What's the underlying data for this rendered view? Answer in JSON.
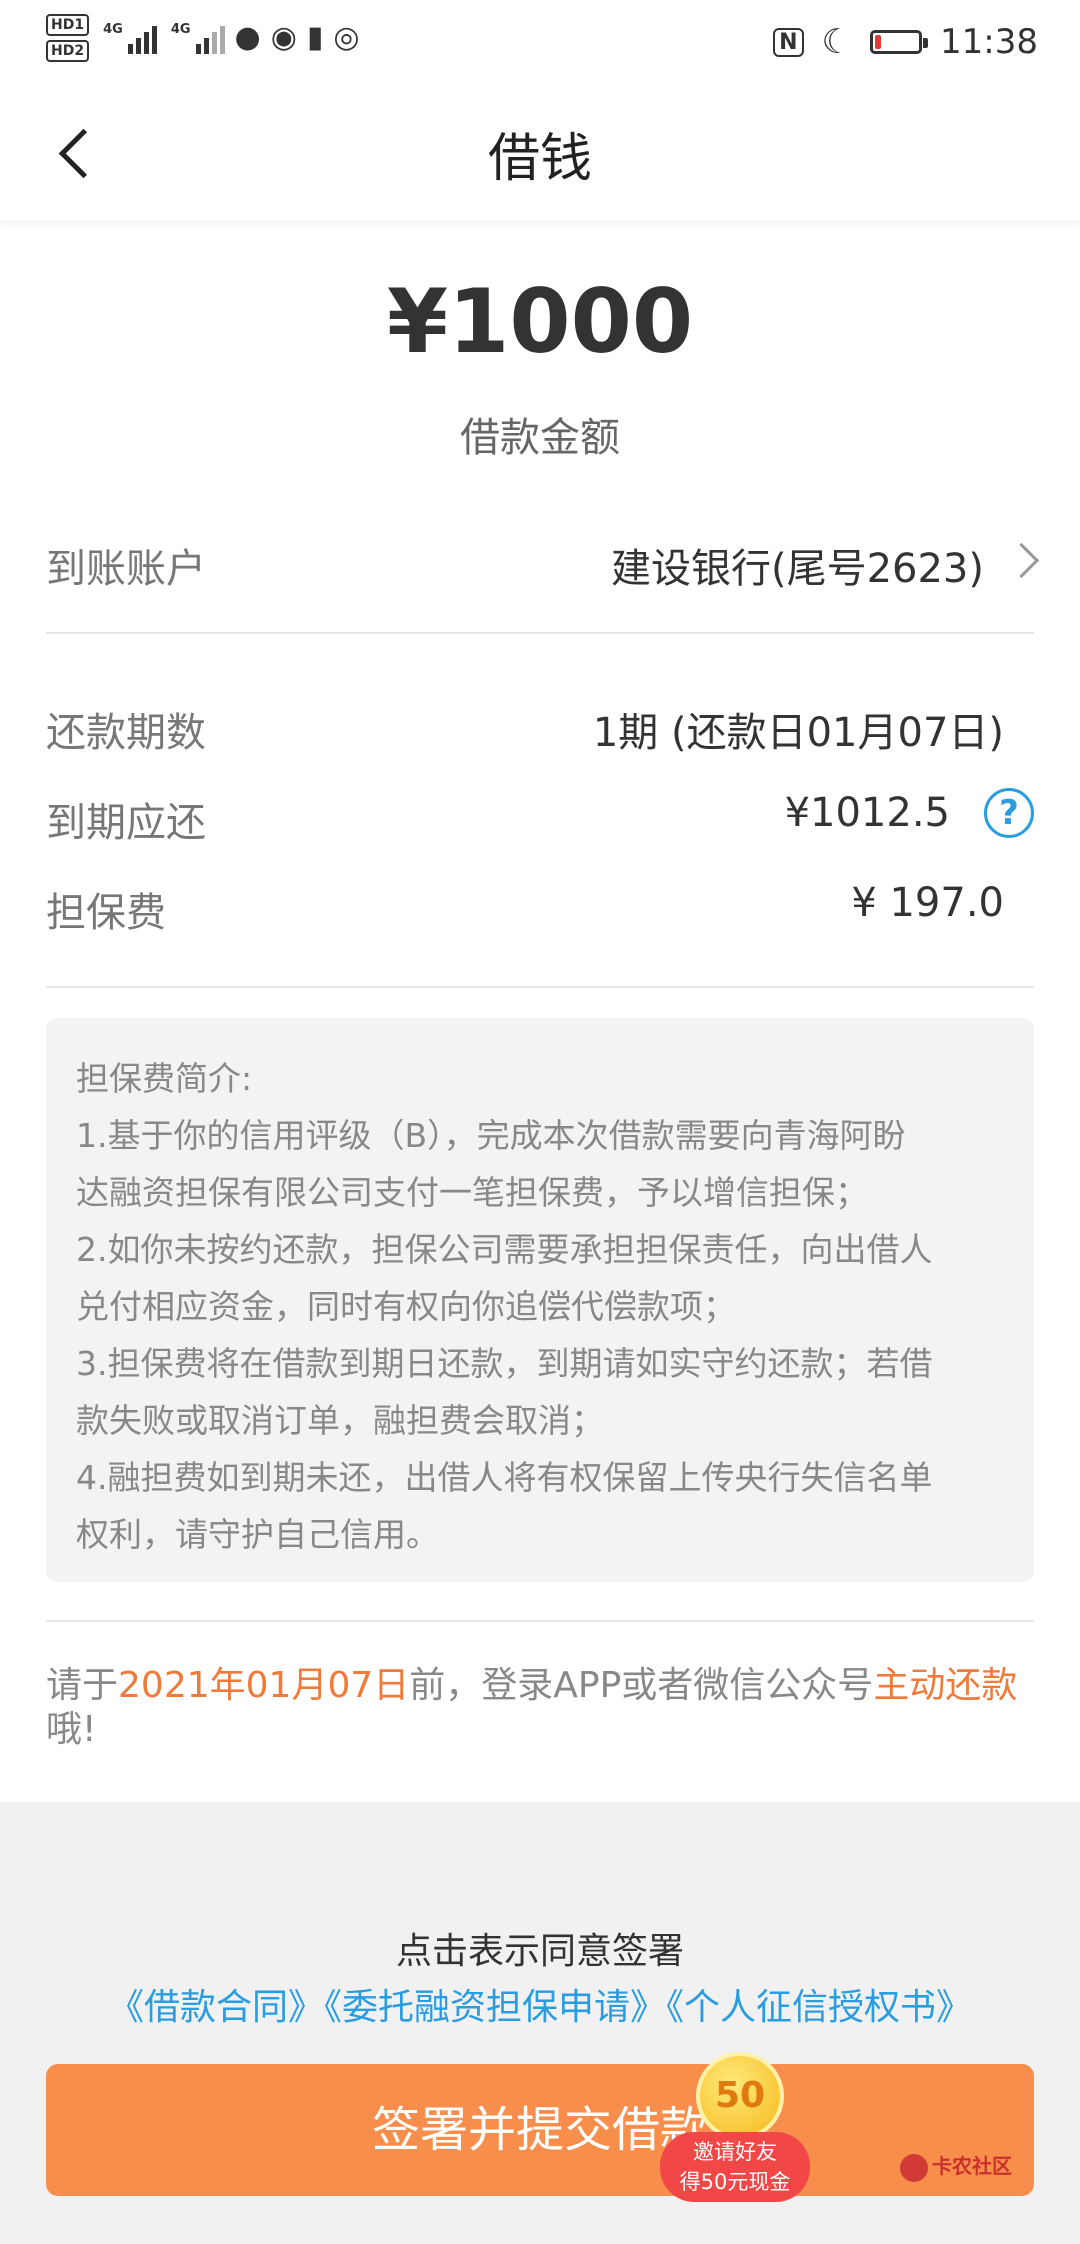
{
  "status_bar": {
    "hd1": "HD1",
    "hd2": "HD2",
    "network1": "4G",
    "network2": "4G",
    "nfc": "N",
    "time": "11:38",
    "battery_level": 0.15,
    "icons": [
      "message-icon",
      "wechat-icon",
      "battery-alert-icon",
      "hotspot-icon",
      "nfc-icon",
      "moon-icon",
      "battery-icon"
    ]
  },
  "header": {
    "title": "借钱"
  },
  "loan": {
    "amount": "¥1000",
    "amount_label": "借款金额"
  },
  "account": {
    "label": "到账账户",
    "value": "建设银行(尾号2623)"
  },
  "details": {
    "periods_label": "还款期数",
    "periods_value": "1期 (还款日01月07日)",
    "due_label": "到期应还",
    "due_value": "¥1012.5",
    "fee_label": "担保费",
    "fee_value": "¥ 197.0"
  },
  "fee_info": {
    "title": "担保费简介:",
    "lines": [
      "1.基于你的信用评级（B），完成本次借款需要向青海阿盼",
      "达融资担保有限公司支付一笔担保费，予以增信担保；",
      "2.如你未按约还款，担保公司需要承担担保责任，向出借人",
      "兑付相应资金，同时有权向你追偿代偿款项；",
      "3.担保费将在借款到期日还款，到期请如实守约还款；若借",
      "款失败或取消订单，融担费会取消；",
      "4.融担费如到期未还，出借人将有权保留上传央行失信名单",
      "权利，请守护自己信用。"
    ]
  },
  "notice": {
    "prefix": "请于",
    "date": "2021年01月07日",
    "middle": "前，登录APP或者微信公众号",
    "action": "主动还款",
    "suffix": "哦!"
  },
  "agreement": {
    "intro": "点击表示同意签署",
    "links": [
      "《借款合同》",
      "《委托融资担保申请》",
      "《个人征信授权书》"
    ]
  },
  "submit_label": "签署并提交借款",
  "promo": {
    "coin": "50",
    "line1": "邀请好友",
    "line2": "得50元现金"
  },
  "watermark": "卡农社区",
  "colors": {
    "accent_orange": "#f88e4c",
    "highlight_orange": "#f07a3a",
    "link_blue": "#2a9ce0",
    "promo_red": "#f14747"
  }
}
